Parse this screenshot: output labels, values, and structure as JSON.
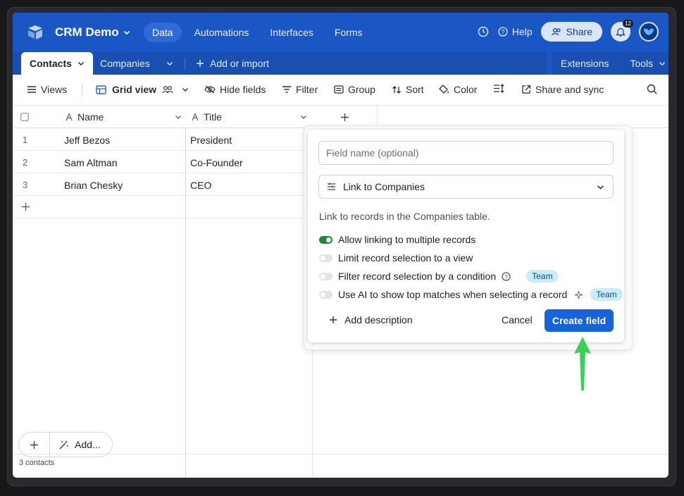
{
  "header": {
    "base_name": "CRM Demo",
    "nav": [
      "Data",
      "Automations",
      "Interfaces",
      "Forms"
    ],
    "help": "Help",
    "share": "Share",
    "notifications_count": "12"
  },
  "tabs": {
    "items": [
      "Contacts",
      "Companies"
    ],
    "add_or_import": "Add or import",
    "extensions": "Extensions",
    "tools": "Tools"
  },
  "viewbar": {
    "views": "Views",
    "grid_view": "Grid view",
    "hide_fields": "Hide fields",
    "filter": "Filter",
    "group": "Group",
    "sort": "Sort",
    "color": "Color",
    "share_sync": "Share and sync"
  },
  "grid": {
    "columns": [
      "Name",
      "Title"
    ],
    "rows": [
      {
        "num": "1",
        "name": "Jeff Bezos",
        "title": "President"
      },
      {
        "num": "2",
        "name": "Sam Altman",
        "title": "Co-Founder"
      },
      {
        "num": "3",
        "name": "Brian Chesky",
        "title": "CEO"
      }
    ],
    "footer_count": "3 contacts",
    "add_label": "Add..."
  },
  "popup": {
    "field_placeholder": "Field name (optional)",
    "type": "Link to Companies",
    "description": "Link to records in the Companies table.",
    "options": [
      {
        "label": "Allow linking to multiple records",
        "on": true
      },
      {
        "label": "Limit record selection to a view",
        "on": false
      },
      {
        "label": "Filter record selection by a condition",
        "on": false,
        "badge": "Team"
      },
      {
        "label": "Use AI to show top matches when selecting a record",
        "on": false,
        "badge": "Team"
      }
    ],
    "add_description": "Add description",
    "cancel": "Cancel",
    "create": "Create field"
  },
  "colors": {
    "brand": "#1b57c4",
    "primary_button": "#1763d8",
    "toggle_on": "#1b8a3a",
    "arrow": "#3ecf5a"
  }
}
